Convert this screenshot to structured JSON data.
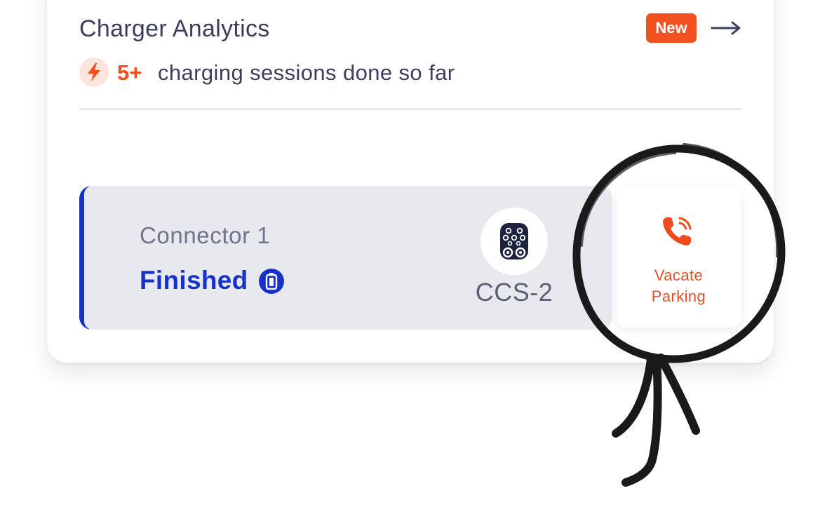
{
  "analytics": {
    "title": "Charger Analytics",
    "badge": "New",
    "arrow_icon": "arrow-right-icon",
    "sessions_icon": "lightning-bolt-icon",
    "sessions_count": "5+",
    "sessions_text": "charging sessions done so far"
  },
  "connector": {
    "name": "Connector 1",
    "status": "Finished",
    "status_icon": "battery-icon",
    "plug_icon": "ccs2-plug-icon",
    "plug_type": "CCS-2"
  },
  "vacate": {
    "icon": "phone-call-icon",
    "line1": "Vacate",
    "line2": "Parking"
  },
  "colors": {
    "accent_orange": "#f2501e",
    "accent_blue": "#1633c9",
    "text_dark": "#3b3f5c",
    "connector_bg": "#e8e9ee"
  }
}
